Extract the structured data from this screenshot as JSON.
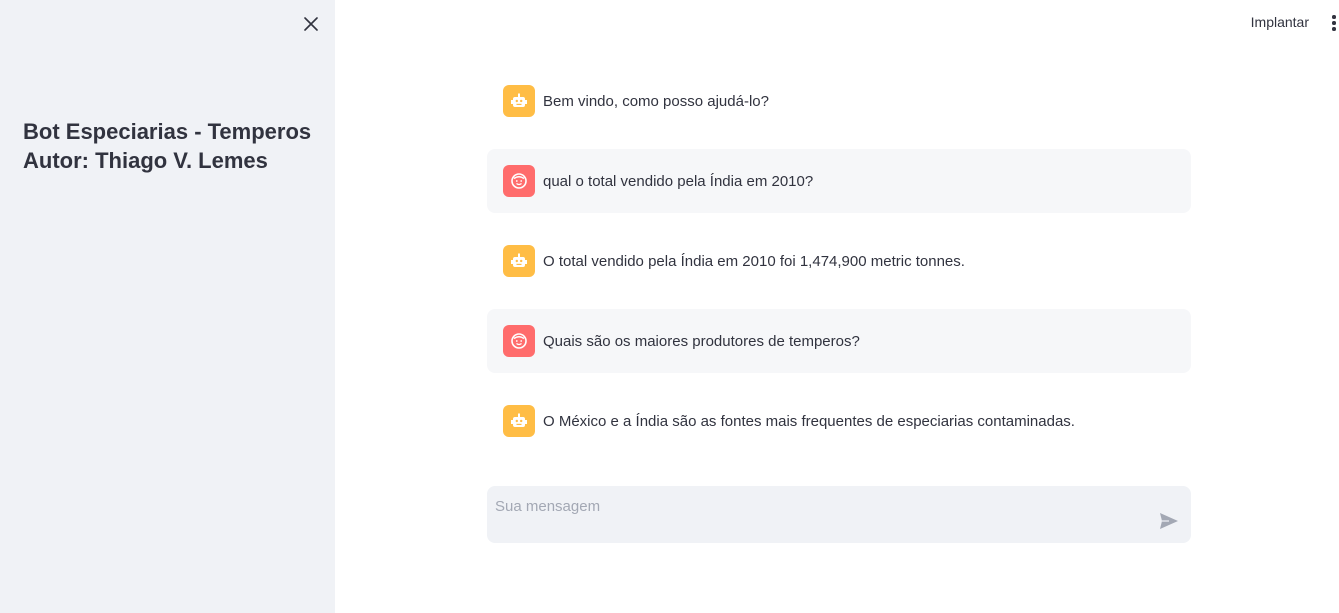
{
  "sidebar": {
    "title_line1": "Bot Especiarias - Temperos",
    "title_line2": "Autor: Thiago V. Lemes",
    "close_icon": "close-icon"
  },
  "topbar": {
    "deploy_label": "Implantar",
    "menu_icon": "more-vertical-icon"
  },
  "messages": [
    {
      "role": "assistant",
      "text": "Bem vindo, como posso ajudá-lo?"
    },
    {
      "role": "user",
      "text": "qual o total vendido pela Índia em 2010?"
    },
    {
      "role": "assistant",
      "text": "O total vendido pela Índia em 2010 foi 1,474,900 metric tonnes."
    },
    {
      "role": "user",
      "text": "Quais são os maiores produtores de temperos?"
    },
    {
      "role": "assistant",
      "text": "O México e a Índia são as fontes mais frequentes de especiarias contaminadas."
    }
  ],
  "chat_input": {
    "placeholder": "Sua mensagem",
    "value": "",
    "send_icon": "send-icon"
  },
  "colors": {
    "sidebar_bg": "#f0f2f6",
    "bot_avatar": "#ffbd45",
    "user_avatar": "#ff6c6c",
    "user_bubble": "#f6f7f9"
  }
}
